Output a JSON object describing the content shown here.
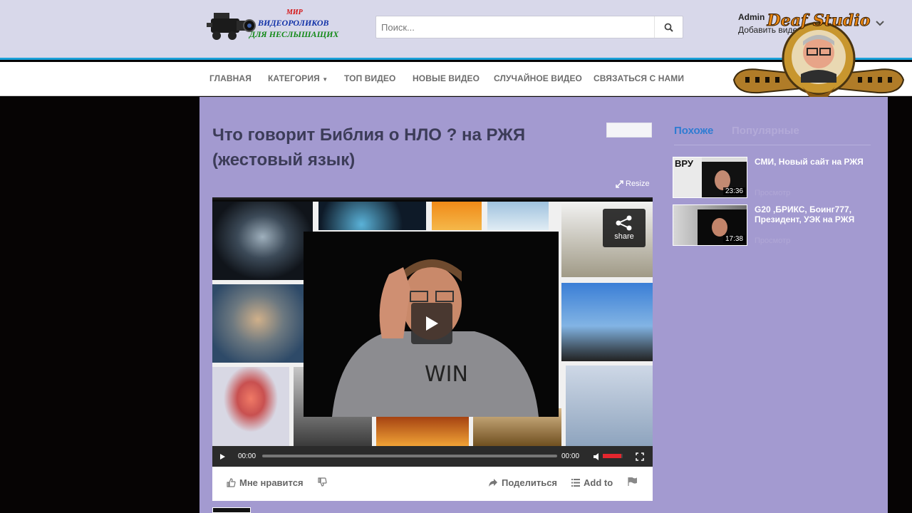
{
  "header": {
    "logo_lines": [
      "МИР",
      "ВИДЕОРОЛИКОВ",
      "ДЛЯ НЕСЛЫШАЩИХ"
    ],
    "search_placeholder": "Поиск...",
    "user_name": "Admin",
    "user_action": "Добавить видео",
    "badge_text": "Deaf Studio",
    "accent_color": "#1aa0d8"
  },
  "nav": {
    "items": [
      "ГЛАВНАЯ",
      "КАТЕГОРИЯ",
      "ТОП ВИДЕО",
      "НОВЫЕ ВИДЕО",
      "СЛУЧАЙНОЕ ВИДЕО",
      "СВЯЗАТЬСЯ С НАМИ"
    ]
  },
  "video": {
    "title": "Что говорит Библия о НЛО ? на РЖЯ (жестовый язык)",
    "resize_label": "Resize",
    "share_label": "share",
    "shirt_text": "WIN",
    "time_current": "00:00",
    "time_total": "00:00"
  },
  "actions": {
    "like": "Мне нравится",
    "share": "Поделиться",
    "add_to": "Add to"
  },
  "sidebar": {
    "tabs": [
      "Похоже",
      "Популярные"
    ],
    "related": [
      {
        "title": "СМИ, Новый сайт на РЖЯ",
        "duration": "23:36",
        "meta": "Просмотр",
        "thumb_text": "ВРУ"
      },
      {
        "title": "G20 ,БРИКС, Боинг777, Президент, УЭК на РЖЯ",
        "duration": "17:38",
        "meta": "Просмотр"
      }
    ]
  }
}
